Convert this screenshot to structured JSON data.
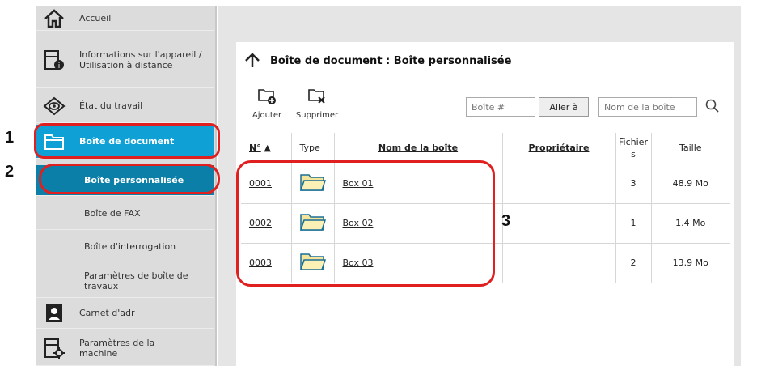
{
  "sidebar": {
    "items": [
      {
        "label": "Accueil",
        "icon": "home-icon"
      },
      {
        "label": "Informations sur l'appareil / Utilisation à distance",
        "icon": "device-info-icon"
      },
      {
        "label": "État du travail",
        "icon": "job-status-icon"
      },
      {
        "label": "Boîte de document",
        "icon": "folder-icon"
      },
      {
        "label": "Boîte personnalisée"
      },
      {
        "label": "Boîte de FAX"
      },
      {
        "label": "Boîte d'interrogation"
      },
      {
        "label": "Paramètres de boîte de travaux"
      },
      {
        "label": "Carnet d'adr",
        "icon": "address-book-icon"
      },
      {
        "label": "Paramètres de la machine",
        "icon": "machine-settings-icon"
      }
    ]
  },
  "main": {
    "title": "Boîte de document : Boîte personnalisée",
    "toolbar": {
      "add_label": "Ajouter",
      "delete_label": "Supprimer",
      "box_number_placeholder": "Boîte #",
      "goto_label": "Aller à",
      "box_name_placeholder": "Nom de la boîte"
    },
    "table": {
      "headers": {
        "number": "N°",
        "type": "Type",
        "name": "Nom de la boîte",
        "owner": "Propriétaire",
        "files": "Fichiers",
        "size": "Taille"
      },
      "rows": [
        {
          "number": "0001",
          "name": "Box 01",
          "owner": "",
          "files": "3",
          "size": "48.9 Mo"
        },
        {
          "number": "0002",
          "name": "Box 02",
          "owner": "",
          "files": "1",
          "size": "1.4 Mo"
        },
        {
          "number": "0003",
          "name": "Box 03",
          "owner": "",
          "files": "2",
          "size": "13.9 Mo"
        }
      ]
    }
  },
  "callouts": {
    "one": "1",
    "two": "2",
    "three": "3"
  },
  "colors": {
    "selected": "#0fa1d6",
    "selected_dark": "#0b7fa8",
    "callout": "#e02020"
  }
}
